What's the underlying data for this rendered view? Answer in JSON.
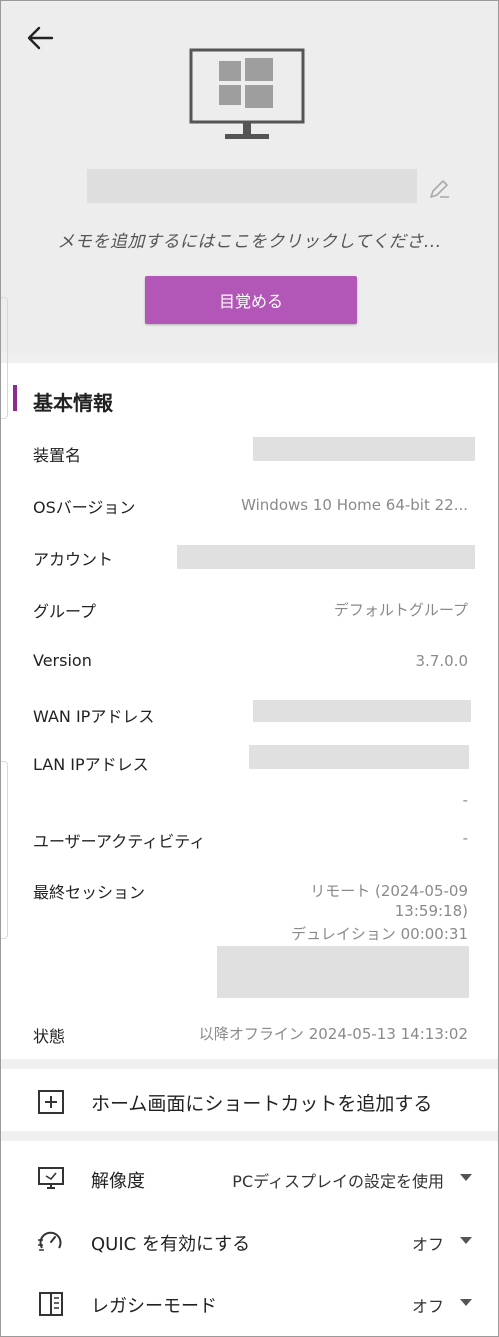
{
  "header": {
    "memo_placeholder": "メモを追加するにはここをクリックしてくださ...",
    "wake_button": "目覚める",
    "accent_color": "#b257b8"
  },
  "basic_info": {
    "title": "基本情報",
    "rows": [
      {
        "label": "装置名",
        "value": ""
      },
      {
        "label": "OSバージョン",
        "value": "Windows 10 Home 64-bit 22..."
      },
      {
        "label": "アカウント",
        "value": ""
      },
      {
        "label": "グループ",
        "value": "デフォルトグループ"
      },
      {
        "label": "Version",
        "value": "3.7.0.0"
      },
      {
        "label": "WAN IPアドレス",
        "value": ""
      },
      {
        "label": "LAN IPアドレス",
        "value": ""
      },
      {
        "label": "",
        "value": "-"
      },
      {
        "label": "ユーザーアクティビティ",
        "value": "-"
      }
    ],
    "last_session": {
      "label": "最終セッション",
      "line1": "リモート (2024-05-09",
      "line2": "13:59:18)",
      "line3": "デュレイション 00:00:31"
    },
    "status": {
      "label": "状態",
      "value": "以降オフライン  2024-05-13 14:13:02"
    }
  },
  "actions": {
    "add_shortcut": "ホーム画面にショートカットを追加する"
  },
  "settings": {
    "resolution": {
      "label": "解像度",
      "value": "PCディスプレイの設定を使用"
    },
    "quic": {
      "label": "QUIC を有効にする",
      "value": "オフ"
    },
    "legacy": {
      "label": "レガシーモード",
      "value": "オフ"
    }
  }
}
